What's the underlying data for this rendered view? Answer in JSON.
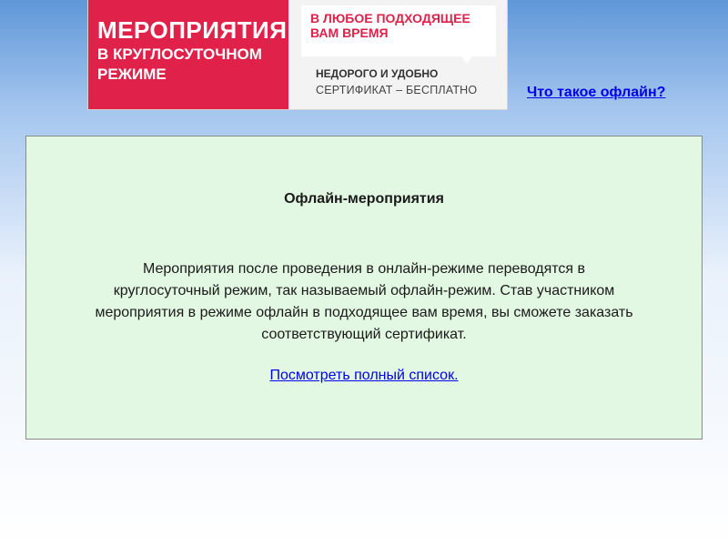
{
  "banner": {
    "left_lines": [
      "МЕРОПРИЯТИЯ",
      "В КРУГЛОСУТОЧНОМ",
      "РЕЖИМЕ"
    ],
    "bubble_lines": [
      "В ЛЮБОЕ ПОДХОДЯЩЕЕ",
      "ВАМ ВРЕМЯ"
    ],
    "tagline": "НЕДОРОГО И УДОБНО",
    "certificate": "СЕРТИФИКАТ – БЕСПЛАТНО"
  },
  "header_link": "Что такое офлайн?",
  "info": {
    "title": "Офлайн-мероприятия",
    "body_lines": [
      "Мероприятия после проведения в онлайн-режиме переводятся в",
      "круглосуточный режим, так называемый офлайн-режим. Став участником",
      "мероприятия в режиме офлайн в подходящее вам время, вы сможете заказать",
      "соответствующий сертификат."
    ],
    "link": "Посмотреть полный список."
  },
  "colors": {
    "brand_red": "#e0224a",
    "panel_green": "#e3f8e3",
    "link_blue": "#0000ee"
  }
}
